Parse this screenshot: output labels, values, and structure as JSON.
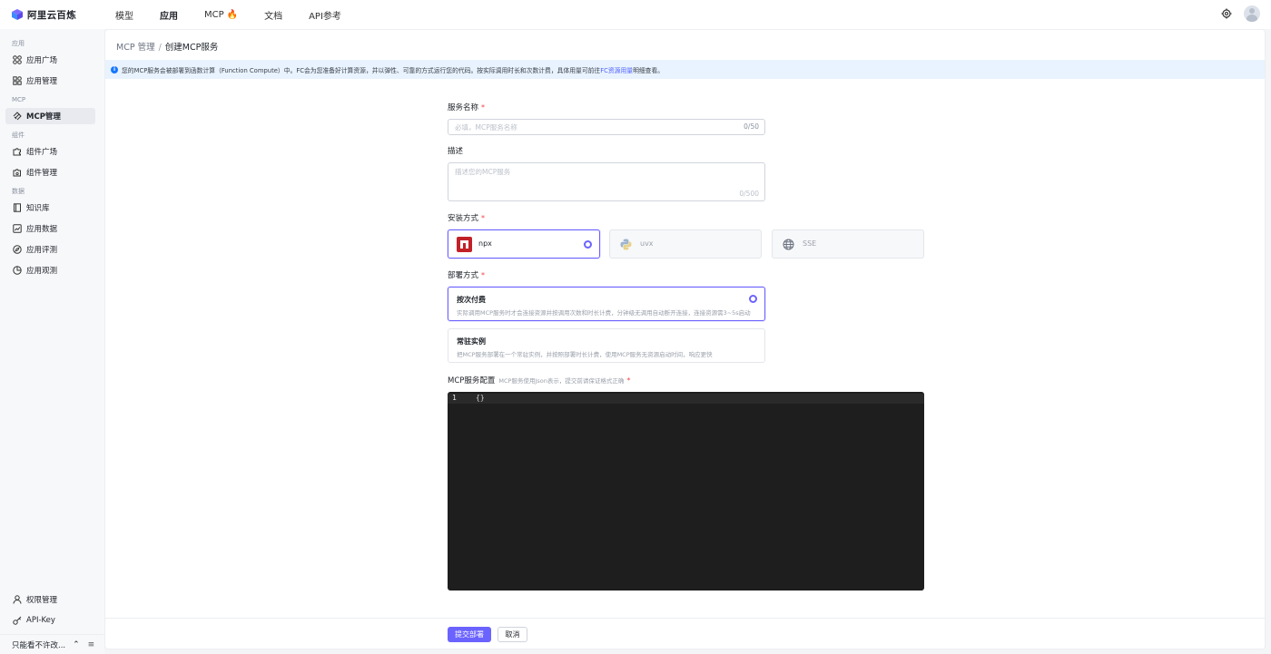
{
  "brand": {
    "name": "阿里云百炼",
    "logo_icon": "bailian-logo-icon"
  },
  "topnav": {
    "items": [
      {
        "label": "模型"
      },
      {
        "label": "应用"
      },
      {
        "label": "MCP",
        "badge_icon": "fire-icon"
      },
      {
        "label": "文档"
      },
      {
        "label": "API参考"
      }
    ],
    "active": "应用"
  },
  "sidebar": {
    "sections": [
      {
        "title": "应用",
        "items": [
          "应用广场",
          "应用管理"
        ]
      },
      {
        "title": "MCP",
        "items": [
          "MCP管理"
        ]
      },
      {
        "title": "组件",
        "items": [
          "组件广场",
          "组件管理"
        ]
      },
      {
        "title": "数据",
        "items": [
          "知识库",
          "应用数据",
          "应用评测",
          "应用观测"
        ]
      }
    ],
    "active_item": "MCP管理",
    "bottom": {
      "permissions": "权限管理",
      "api_key": "API-Key",
      "workspace": "只能看不许改..."
    }
  },
  "breadcrumb": {
    "parent": "MCP 管理",
    "separator": "/",
    "current": "创建MCP服务"
  },
  "notice": {
    "text": "您的MCP服务会被部署到函数计算（Function Compute）中。FC会为您准备好计算资源，并以弹性、可靠的方式运行您的代码。按实际调用时长和次数计费，具体用量可前往",
    "link": "FC资源用量",
    "suffix": "明细查看。"
  },
  "form": {
    "service_name": {
      "label": "服务名称",
      "placeholder": "必填，MCP服务名称",
      "counter": "0/50"
    },
    "description": {
      "label": "描述",
      "placeholder": "描述您的MCP服务",
      "counter": "0/500"
    },
    "install": {
      "label": "安装方式",
      "options": [
        {
          "name": "npx",
          "icon": "npm-icon",
          "selected": true
        },
        {
          "name": "uvx",
          "icon": "python-icon",
          "selected": false
        },
        {
          "name": "SSE",
          "icon": "globe-icon",
          "selected": false
        }
      ]
    },
    "deploy": {
      "label": "部署方式",
      "options": [
        {
          "title": "按次付费",
          "desc": "实际调用MCP服务时才会连接资源并按调用次数和时长计费，分钟级无调用自动断开连接，连接资源需3~5s启动",
          "selected": true
        },
        {
          "title": "常驻实例",
          "desc": "把MCP服务部署在一个常驻实例，并按照部署时长计费，使用MCP服务无资源启动时间，响应更快",
          "selected": false
        }
      ]
    },
    "config": {
      "label": "MCP服务配置",
      "hint": "MCP服务使用Json表示，提交前请保证格式正确",
      "line_number": "1",
      "code": "{}"
    }
  },
  "footer": {
    "submit": "提交部署",
    "cancel": "取消"
  },
  "colors": {
    "accent": "#6b63ff",
    "required": "#f53f3f",
    "notice_bg": "#e8f3ff",
    "editor_bg": "#1e1e1e"
  }
}
